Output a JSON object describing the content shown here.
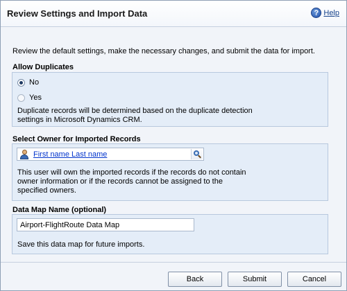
{
  "header": {
    "title": "Review Settings and Import Data",
    "help_label": "Help"
  },
  "intro": "Review the default settings, make the necessary changes, and submit the data for import.",
  "allow_duplicates": {
    "heading": "Allow Duplicates",
    "options": [
      {
        "label": "No",
        "selected": true
      },
      {
        "label": "Yes",
        "selected": false
      }
    ],
    "description_line1": "Duplicate records will be determined based on the duplicate detection",
    "description_line2": "settings in Microsoft Dynamics CRM."
  },
  "owner": {
    "heading": "Select Owner for Imported Records",
    "value": "First name Last name",
    "description_line1": "This user will own the imported records if the records do not contain",
    "description_line2": "owner information or if the records cannot be assigned to the",
    "description_line3": "specified owners."
  },
  "data_map": {
    "heading": "Data Map Name (optional)",
    "value": "Airport-FlightRoute Data Map",
    "description": "Save this data map for future imports."
  },
  "footer": {
    "back_label": "Back",
    "submit_label": "Submit",
    "cancel_label": "Cancel"
  },
  "icons": {
    "help": "help-icon",
    "user": "user-icon",
    "lookup": "lookup-icon"
  }
}
